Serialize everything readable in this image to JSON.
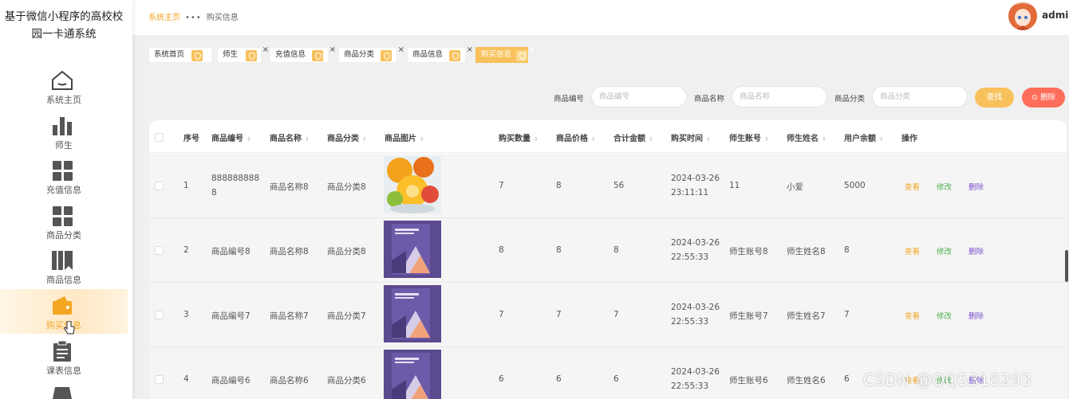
{
  "sidebar": {
    "title_line1": "基于微信小程序的高校校",
    "title_line2": "园一卡通系统",
    "items": [
      {
        "label": "系统主页",
        "icon": "home-icon"
      },
      {
        "label": "师生",
        "icon": "bar-chart-icon"
      },
      {
        "label": "充值信息",
        "icon": "grid-icon"
      },
      {
        "label": "商品分类",
        "icon": "grid-icon"
      },
      {
        "label": "商品信息",
        "icon": "books-icon"
      },
      {
        "label": "购买信息",
        "icon": "wallet-icon",
        "active": true
      },
      {
        "label": "课表信息",
        "icon": "clipboard-icon"
      }
    ]
  },
  "header": {
    "breadcrumb_home": "系统主页",
    "breadcrumb_current": "购买信息",
    "username": "admin"
  },
  "tags": [
    "系统首页",
    "师生",
    "充值信息",
    "商品分类",
    "商品信息",
    "购买信息"
  ],
  "search": {
    "fields": [
      {
        "label": "商品编号",
        "placeholder": "商品编号"
      },
      {
        "label": "商品名称",
        "placeholder": "商品名称"
      },
      {
        "label": "商品分类",
        "placeholder": "商品分类"
      }
    ],
    "find_label": "查找",
    "delete_label": "删除"
  },
  "table": {
    "columns": [
      "序号",
      "商品编号",
      "商品名称",
      "商品分类",
      "商品图片",
      "购买数量",
      "商品价格",
      "合计金额",
      "购买时间",
      "师生账号",
      "师生姓名",
      "用户余额",
      "操作"
    ],
    "actions": {
      "view": "查看",
      "edit": "修改",
      "delete": "删除"
    },
    "rows": [
      {
        "index": "1",
        "code_line1": "888888888",
        "code_line2": "8",
        "name": "商品名称8",
        "category": "商品分类8",
        "image": "fruit",
        "qty": "7",
        "price": "8",
        "total": "56",
        "date": "2024-03-26",
        "time": "23:11:11",
        "account": "11",
        "person": "小爱",
        "balance": "5000"
      },
      {
        "index": "2",
        "code_line1": "商品编号8",
        "code_line2": "",
        "name": "商品名称8",
        "category": "商品分类8",
        "image": "book",
        "qty": "8",
        "price": "8",
        "total": "8",
        "date": "2024-03-26",
        "time": "22:55:33",
        "account": "师生账号8",
        "person": "师生姓名8",
        "balance": "8"
      },
      {
        "index": "3",
        "code_line1": "商品编号7",
        "code_line2": "",
        "name": "商品名称7",
        "category": "商品分类7",
        "image": "book",
        "qty": "7",
        "price": "7",
        "total": "7",
        "date": "2024-03-26",
        "time": "22:55:33",
        "account": "师生账号7",
        "person": "师生姓名7",
        "balance": "7"
      },
      {
        "index": "4",
        "code_line1": "商品编号6",
        "code_line2": "",
        "name": "商品名称6",
        "category": "商品分类6",
        "image": "book",
        "qty": "6",
        "price": "6",
        "total": "6",
        "date": "2024-03-26",
        "time": "22:55:33",
        "account": "师生账号6",
        "person": "师生姓名6",
        "balance": "6"
      }
    ]
  },
  "watermark": "CSDN @QQ5318293",
  "colors": {
    "accent": "#f8c15c",
    "danger": "#ff6d5b",
    "edit": "#4caf50",
    "delete": "#7b4fd0"
  }
}
